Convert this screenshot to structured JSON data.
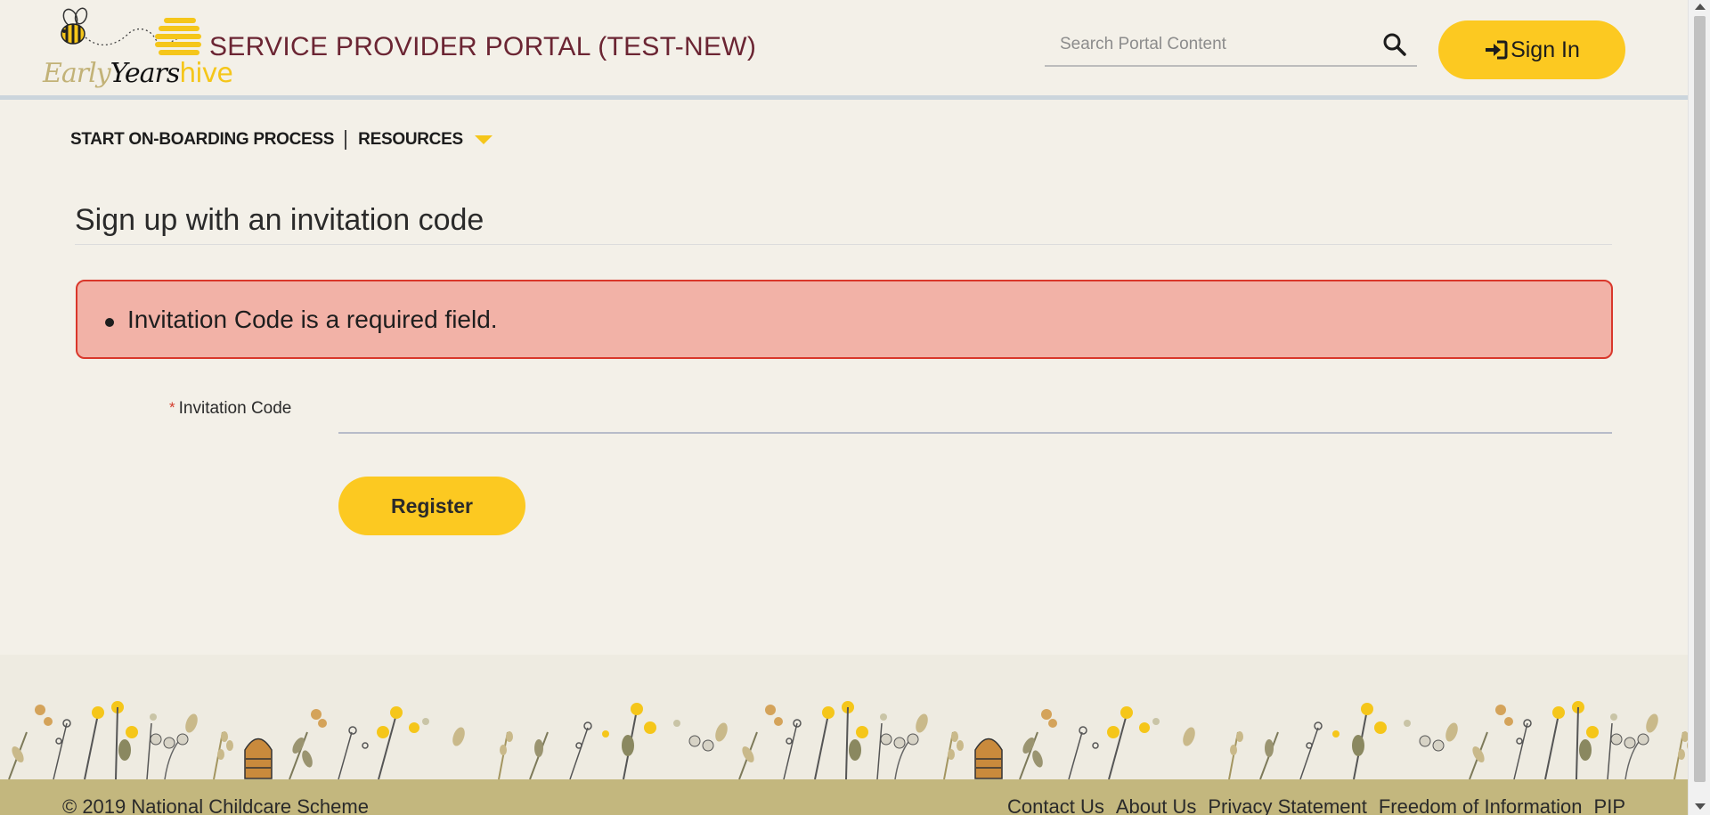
{
  "header": {
    "logo": {
      "word1": "Early",
      "word2": "Years",
      "word3": "hive"
    },
    "portal_title": "SERVICE PROVIDER PORTAL (TEST-NEW)",
    "search_placeholder": "Search Portal Content",
    "sign_in_label": "Sign In"
  },
  "nav": {
    "items": [
      {
        "label": "START ON-BOARDING PROCESS"
      },
      {
        "label": "RESOURCES"
      }
    ]
  },
  "main": {
    "title": "Sign up with an invitation code",
    "errors": [
      "Invitation Code is a required field."
    ],
    "field": {
      "required_marker": "*",
      "label": "Invitation Code",
      "value": ""
    },
    "register_label": "Register"
  },
  "footer": {
    "copyright": "© 2019 National Childcare Scheme",
    "links": [
      "Contact Us",
      "About Us",
      "Privacy Statement",
      "Freedom of Information",
      "PIP"
    ]
  },
  "colors": {
    "accent": "#fcc921",
    "title": "#6b2533",
    "error_bg": "#f2b2a7",
    "error_border": "#d9372b",
    "footer_bar": "#c3b77e",
    "page_bg": "#f3f0e8"
  }
}
